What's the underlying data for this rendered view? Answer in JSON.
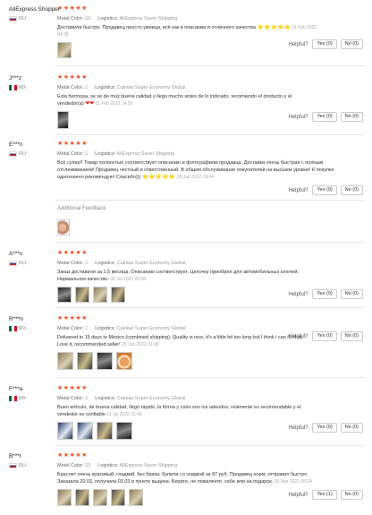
{
  "labels": {
    "metal_color": "Metal Color:",
    "logistics": "Logistics:",
    "helpful": "Helpful?",
    "additional_feedback": "Additional Feedback"
  },
  "colors": {
    "star": "#f45028",
    "heart": "#e0312a"
  },
  "reviews": [
    {
      "user": "AliExpress Shopper",
      "country": "RU",
      "stars": "★★★★★",
      "metal_color": "10",
      "logistics": "AliExpress Saver Shipping",
      "text": "Доставили быстро. Продавец просто умница, всё как в описании и отличного качества",
      "extra": "⭐⭐⭐⭐⭐",
      "date": "11 Feb 2022 04:38",
      "yes": "Yes (0)",
      "no": "No (0)"
    },
    {
      "user": "J***z",
      "country": "MX",
      "stars": "★★★★★",
      "metal_color": "1",
      "logistics": "Cainiao Super Economy Global",
      "text": "Esta hermosa, se ve de muy buena calidad y llego mucho antes de lo indicado, recomiendo el producto y al vendedor(a)",
      "extra": "❤❤",
      "date": "11 Feb 2022 14:50",
      "yes": "Yes (0)",
      "no": "No (0)"
    },
    {
      "user": "E***n",
      "country": "RU",
      "stars": "★★★★★",
      "metal_color": "1",
      "logistics": "AliExpress Saver Shipping",
      "text": "Всё супер!! Товар полностью соответствует описанию и фотографиям продавца. Доставка очень быстрая с полным отслеживанием! Продавец честный и ответственный. В общем обслуживание покупателей на высшем уровне! К покупке однозначно рекомендую! Спасибо)))",
      "extra": "⭐⭐⭐⭐⭐",
      "date": "28 Jan 2022 19:44",
      "yes": "Yes (0)",
      "no": "No (0)"
    },
    {
      "user": "A***v",
      "country": "RU",
      "stars": "★★★★★",
      "metal_color": "1",
      "logistics": "Cainiao Super Economy Global",
      "text": "Заказ доставили за 1,5 месяца. Описанию соответствует. Цепочку приобрел для автомобильных ключей. Нормальное качество.",
      "date": "06 Jul 2022 00:58",
      "yes": "Yes (0)",
      "no": "No (0)"
    },
    {
      "user": "R***n",
      "country": "MX",
      "stars": "★★★★★",
      "metal_color": "1",
      "logistics": "Cainiao Super Economy Global",
      "text": "Delivered in 15 days to Mexico (combined shipping). Quality is nice, it's a little bit too long but I think i can fix that. Love it, recommended seller",
      "extra": "!",
      "date": "29 Jun 2022 01:08",
      "yes": "Yes (0)",
      "no": "No (0)"
    },
    {
      "user": "F***a",
      "country": "MX",
      "stars": "★★★★★",
      "metal_color": "1",
      "logistics": "Cainiao Super Economy Global",
      "text": "Buen artículo, de buena calidad, llegó rápido, la forma y color son los adeudos, realmente es recomendable y el vendedor es confiable",
      "date": "11 Jul 2022 21:40",
      "yes": "Yes (0)",
      "no": "No (0)"
    },
    {
      "user": "B***r",
      "country": "RU",
      "stars": "★★★★★",
      "metal_color": "13",
      "logistics": "AliExpress Saver Shipping",
      "text": "Браслет очень красивый, гладкий, без брака. Купила со скидкой за 87 руб. Продавец норм, отправил быстро. Заказала 20.02, получила 03.03 в пункте выдачи. Берите, не пожалеете, себе или на подарок.",
      "date": "03 Mar 2022 08:24",
      "yes": "Yes (1)",
      "no": "No (0)"
    }
  ]
}
